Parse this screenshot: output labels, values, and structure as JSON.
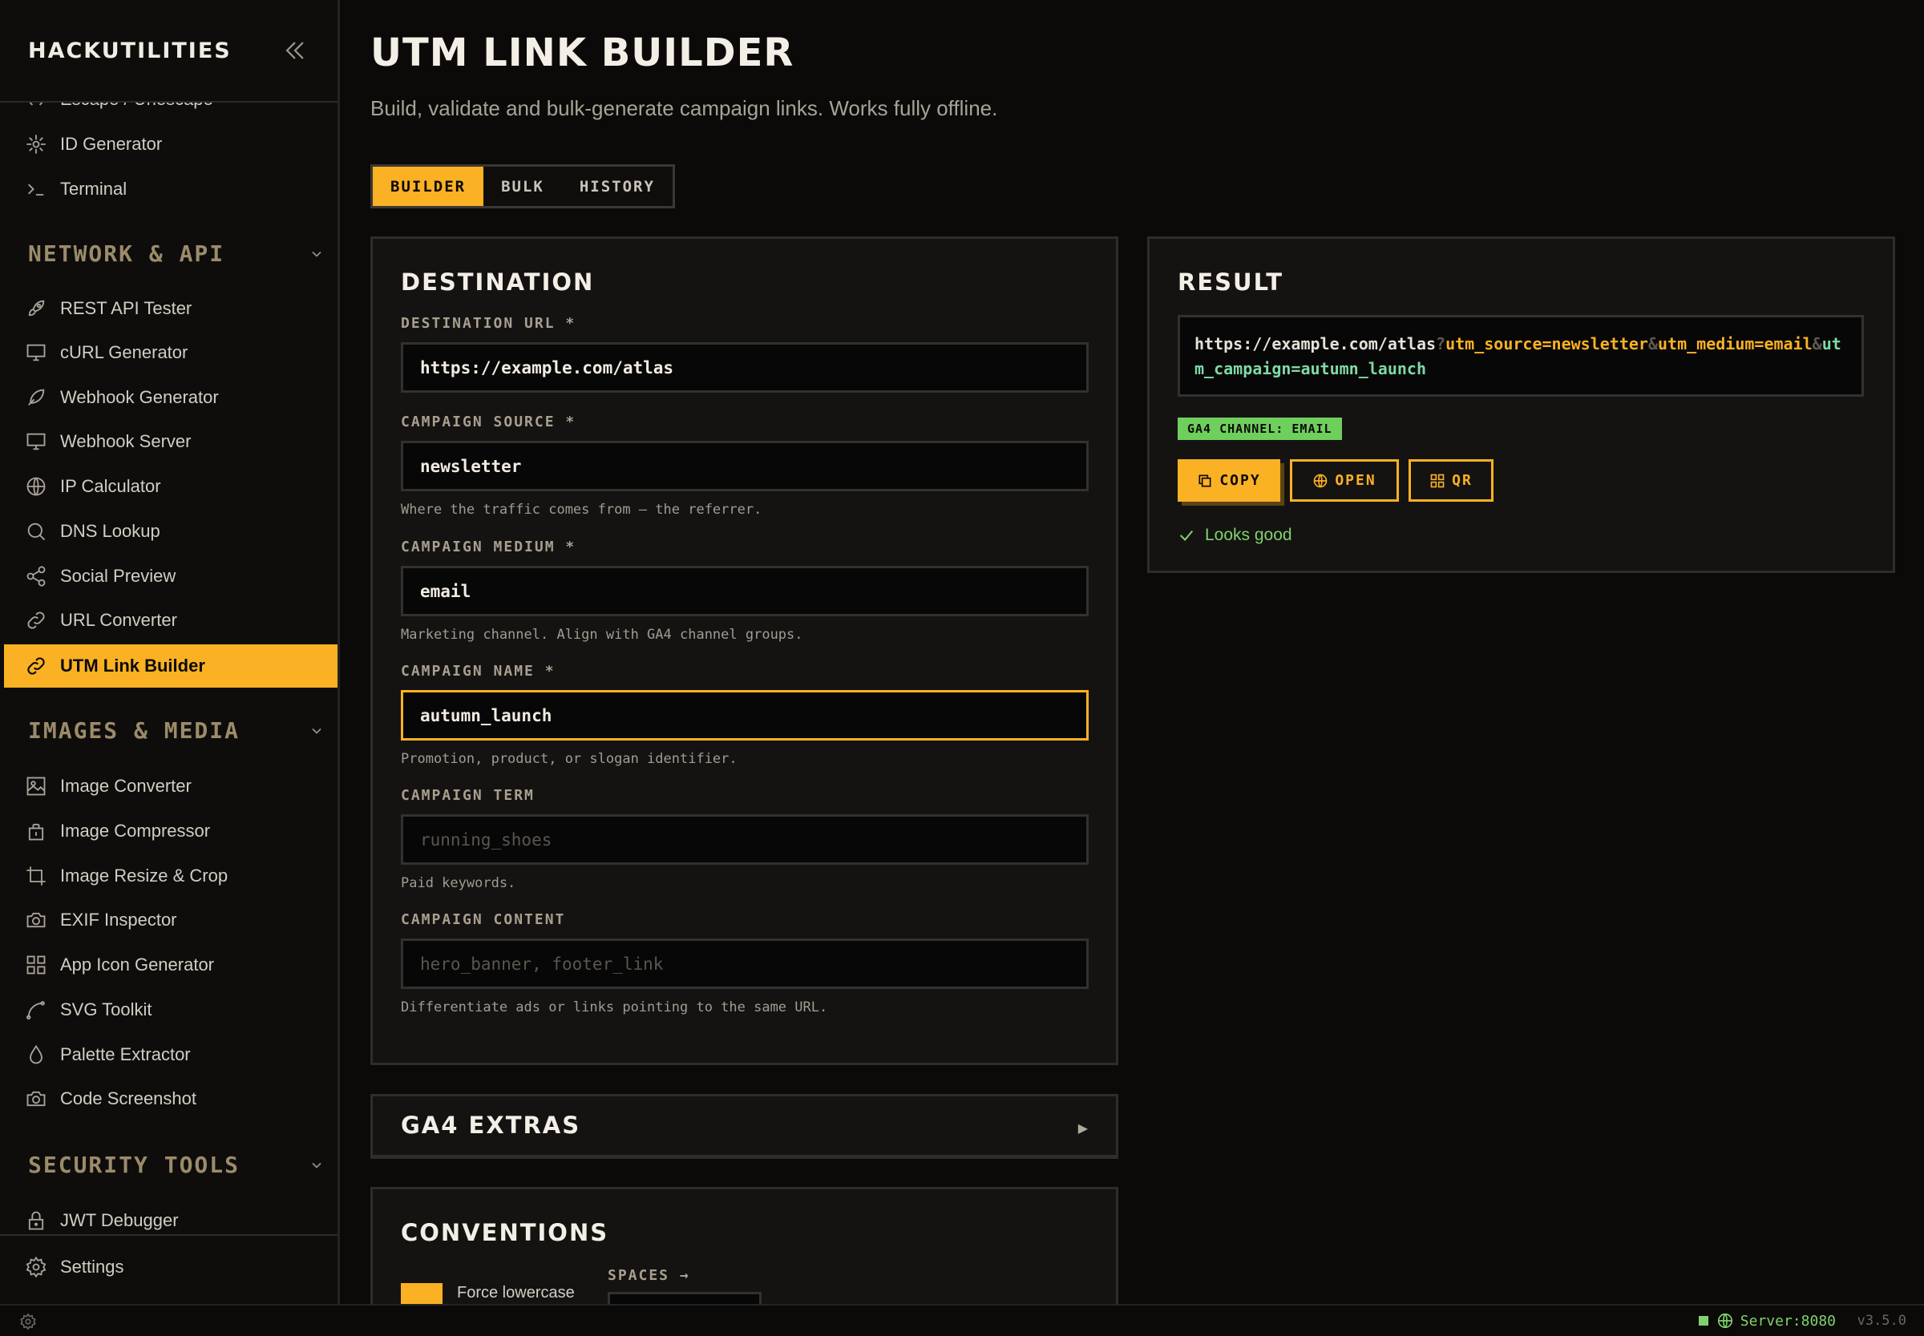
{
  "sidebar": {
    "brand": "HACKUTILITIES",
    "partial_item": "Escape / Unescape",
    "dev_items": [
      {
        "label": "ID Generator",
        "icon": "id-generator-icon"
      },
      {
        "label": "Terminal",
        "icon": "terminal-icon"
      }
    ],
    "sections": {
      "network": "NETWORK & API",
      "images": "IMAGES & MEDIA",
      "security": "SECURITY TOOLS"
    },
    "network_items": [
      {
        "label": "REST API Tester",
        "icon": "rocket-icon"
      },
      {
        "label": "cURL Generator",
        "icon": "monitor-icon"
      },
      {
        "label": "Webhook Generator",
        "icon": "feather-icon"
      },
      {
        "label": "Webhook Server",
        "icon": "monitor-icon"
      },
      {
        "label": "IP Calculator",
        "icon": "globe-icon"
      },
      {
        "label": "DNS Lookup",
        "icon": "search-icon"
      },
      {
        "label": "Social Preview",
        "icon": "share-icon"
      },
      {
        "label": "URL Converter",
        "icon": "link-icon"
      },
      {
        "label": "UTM Link Builder",
        "icon": "link-icon",
        "active": true
      }
    ],
    "image_items": [
      {
        "label": "Image Converter",
        "icon": "image-icon"
      },
      {
        "label": "Image Compressor",
        "icon": "compress-icon"
      },
      {
        "label": "Image Resize & Crop",
        "icon": "crop-icon"
      },
      {
        "label": "EXIF Inspector",
        "icon": "camera-icon"
      },
      {
        "label": "App Icon Generator",
        "icon": "grid-icon"
      },
      {
        "label": "SVG Toolkit",
        "icon": "curve-icon"
      },
      {
        "label": "Palette Extractor",
        "icon": "drop-icon"
      },
      {
        "label": "Code Screenshot",
        "icon": "camera-icon"
      }
    ],
    "security_items": [
      {
        "label": "JWT Debugger",
        "icon": "lock-icon"
      }
    ],
    "settings_label": "Settings"
  },
  "page": {
    "title": "UTM LINK BUILDER",
    "subtitle": "Build, validate and bulk-generate campaign links. Works fully offline."
  },
  "tabs": [
    {
      "label": "BUILDER",
      "active": true
    },
    {
      "label": "BULK",
      "active": false
    },
    {
      "label": "HISTORY",
      "active": false
    }
  ],
  "destination": {
    "title": "DESTINATION",
    "fields": [
      {
        "label": "DESTINATION URL *",
        "value": "https://example.com/atlas",
        "placeholder": "",
        "hint": ""
      },
      {
        "label": "CAMPAIGN SOURCE *",
        "value": "newsletter",
        "placeholder": "",
        "hint": "Where the traffic comes from — the referrer."
      },
      {
        "label": "CAMPAIGN MEDIUM *",
        "value": "email",
        "placeholder": "",
        "hint": "Marketing channel. Align with GA4 channel groups."
      },
      {
        "label": "CAMPAIGN NAME *",
        "value": "autumn_launch",
        "placeholder": "",
        "hint": "Promotion, product, or slogan identifier."
      },
      {
        "label": "CAMPAIGN TERM",
        "value": "",
        "placeholder": "running_shoes",
        "hint": "Paid keywords."
      },
      {
        "label": "CAMPAIGN CONTENT",
        "value": "",
        "placeholder": "hero_banner, footer_link",
        "hint": "Differentiate ads or links pointing to the same URL."
      }
    ]
  },
  "ga4_extras": {
    "title": "GA4 EXTRAS",
    "arrow": "▶"
  },
  "conventions": {
    "title": "CONVENTIONS",
    "force_lowercase_label": "Force lowercase",
    "force_lowercase_checked": true,
    "spaces_label": "SPACES →"
  },
  "result": {
    "title": "RESULT",
    "url_parts": {
      "base": "https://example.com/atlas",
      "q": "?",
      "source": "utm_source=newsletter",
      "amp1": "&",
      "medium": "utm_medium=email",
      "amp2": "&",
      "campaign": "utm_campaign=autumn_launch"
    },
    "badge": "GA4 CHANNEL: EMAIL",
    "buttons": {
      "copy": "COPY",
      "open": "OPEN",
      "qr": "QR"
    },
    "status": "Looks good"
  },
  "statusbar": {
    "server": "Server:8080",
    "version": "v3.5.0"
  },
  "colors": {
    "accent": "#fbb124",
    "success": "#7fd36a",
    "background": "#0b0a09"
  }
}
